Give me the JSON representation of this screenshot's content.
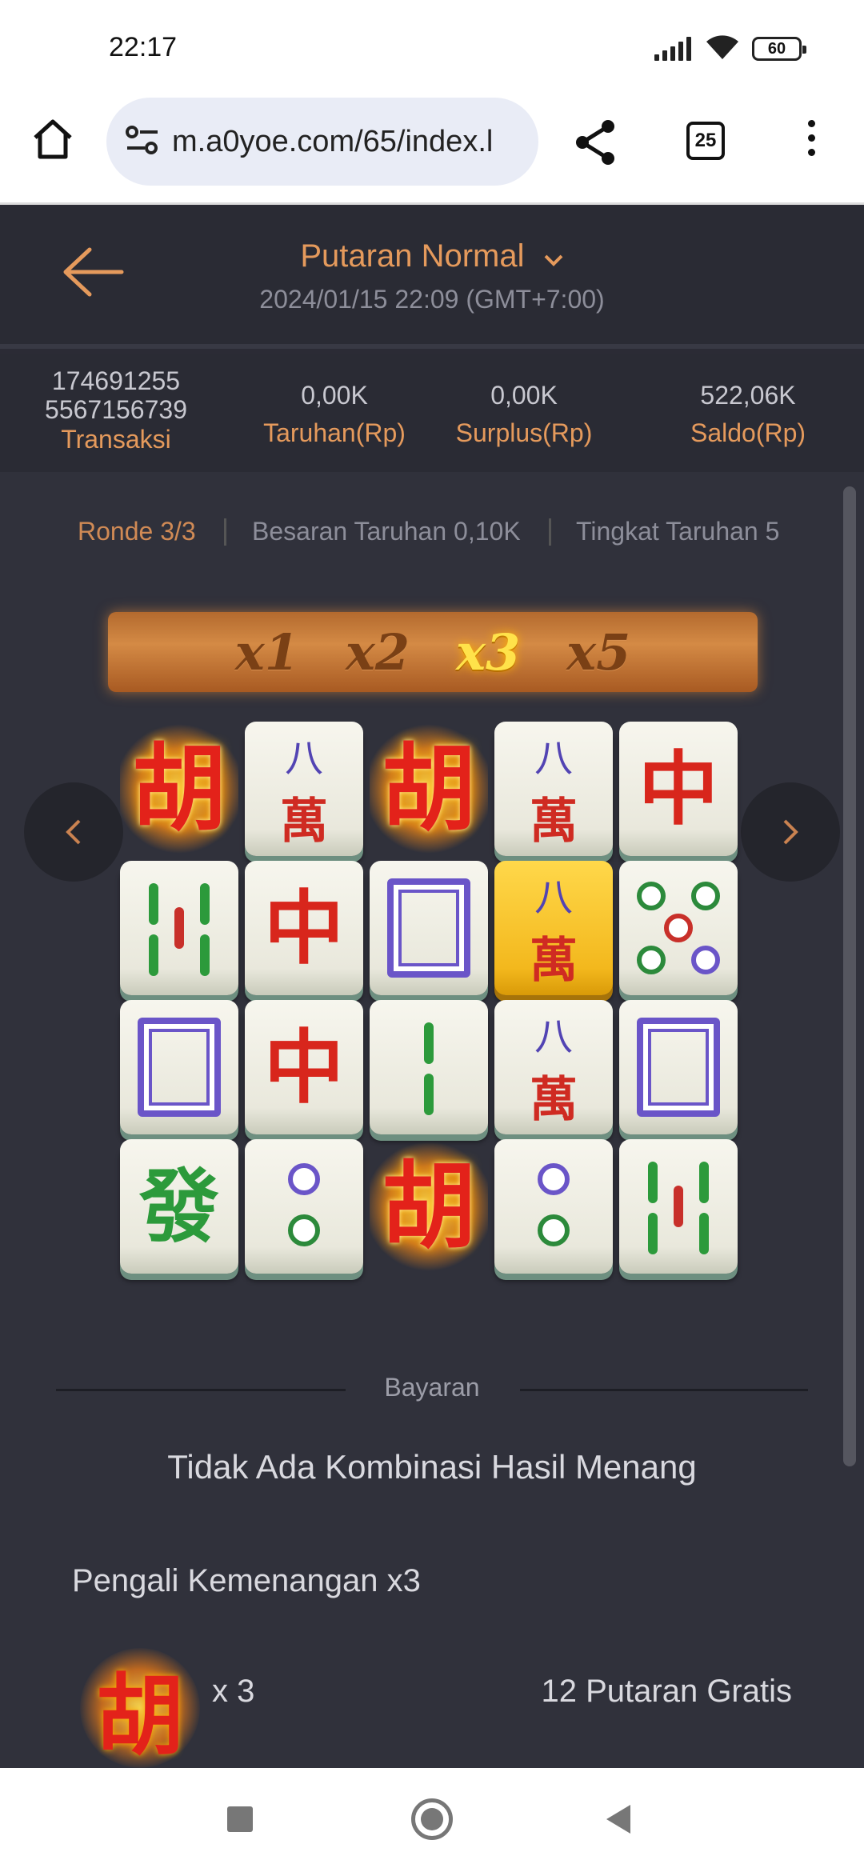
{
  "status_bar": {
    "time": "22:17",
    "battery": "60"
  },
  "browser": {
    "url": "m.a0yoe.com/65/index.l",
    "tab_count": "25"
  },
  "header": {
    "title": "Putaran Normal",
    "datetime": "2024/01/15 22:09 (GMT+7:00)"
  },
  "stats": {
    "transaction_id_1": "174691255",
    "transaction_id_2": "5567156739",
    "transaction_label": "Transaksi",
    "bet_value": "0,00K",
    "bet_label": "Taruhan(Rp)",
    "surplus_value": "0,00K",
    "surplus_label": "Surplus(Rp)",
    "balance_value": "522,06K",
    "balance_label": "Saldo(Rp)"
  },
  "round_info": {
    "round": "Ronde 3/3",
    "bet_size": "Besaran Taruhan 0,10K",
    "bet_level": "Tingkat Taruhan 5"
  },
  "multipliers": [
    {
      "label": "x1",
      "active": false
    },
    {
      "label": "x2",
      "active": false
    },
    {
      "label": "x3",
      "active": true
    },
    {
      "label": "x5",
      "active": false
    }
  ],
  "board": [
    [
      "hu",
      "wan8",
      "hu",
      "wan8",
      "zhong"
    ],
    [
      "bamboo5",
      "zhong",
      "white",
      "wan8-gold",
      "circle5"
    ],
    [
      "white",
      "zhong",
      "bamboo2",
      "wan8",
      "white"
    ],
    [
      "fa",
      "circle2",
      "hu",
      "circle2",
      "bamboo5"
    ]
  ],
  "glyphs": {
    "hu": "胡",
    "wan_top": "八",
    "wan_bot": "萬",
    "zhong": "中",
    "fa": "發"
  },
  "payout": {
    "label": "Bayaran",
    "no_win": "Tidak Ada Kombinasi Hasil Menang",
    "multiplier_text": "Pengali Kemenangan x3",
    "symbol_count": "x 3",
    "free_spins": "12 Putaran Gratis"
  },
  "colors": {
    "accent": "#e59a5c",
    "background": "#30313b"
  }
}
